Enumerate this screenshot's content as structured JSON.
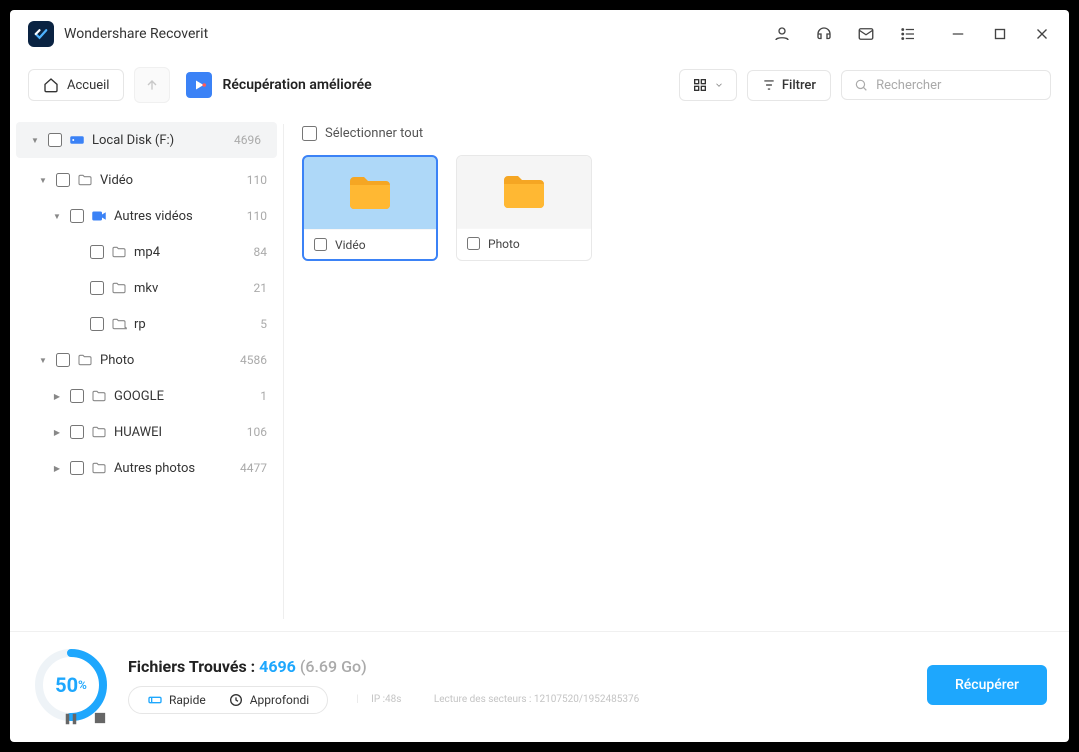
{
  "app": {
    "title": "Wondershare Recoverit"
  },
  "toolbar": {
    "home": "Accueil",
    "breadcrumb": "Récupération améliorée",
    "filter": "Filtrer",
    "search_placeholder": "Rechercher"
  },
  "tree": {
    "root": {
      "label": "Local Disk (F:)",
      "count": "4696"
    },
    "video": {
      "label": "Vidéo",
      "count": "110"
    },
    "other_videos": {
      "label": "Autres vidéos",
      "count": "110"
    },
    "mp4": {
      "label": "mp4",
      "count": "84"
    },
    "mkv": {
      "label": "mkv",
      "count": "21"
    },
    "rp": {
      "label": "rp",
      "count": "5"
    },
    "photo": {
      "label": "Photo",
      "count": "4586"
    },
    "google": {
      "label": "GOOGLE",
      "count": "1"
    },
    "huawei": {
      "label": "HUAWEI",
      "count": "106"
    },
    "other_photos": {
      "label": "Autres photos",
      "count": "4477"
    }
  },
  "main": {
    "select_all": "Sélectionner tout",
    "folders": {
      "video": "Vidéo",
      "photo": "Photo"
    }
  },
  "footer": {
    "progress_pct": "50",
    "found_label": "Fichiers Trouvés : ",
    "found_count": "4696",
    "found_size": "(6.69 Go)",
    "mode_fast": "Rapide",
    "mode_deep": "Approfondi",
    "ip": "IP :48s",
    "sectors": "Lecture des secteurs : 12107520/1952485376",
    "recover": "Récupérer"
  }
}
